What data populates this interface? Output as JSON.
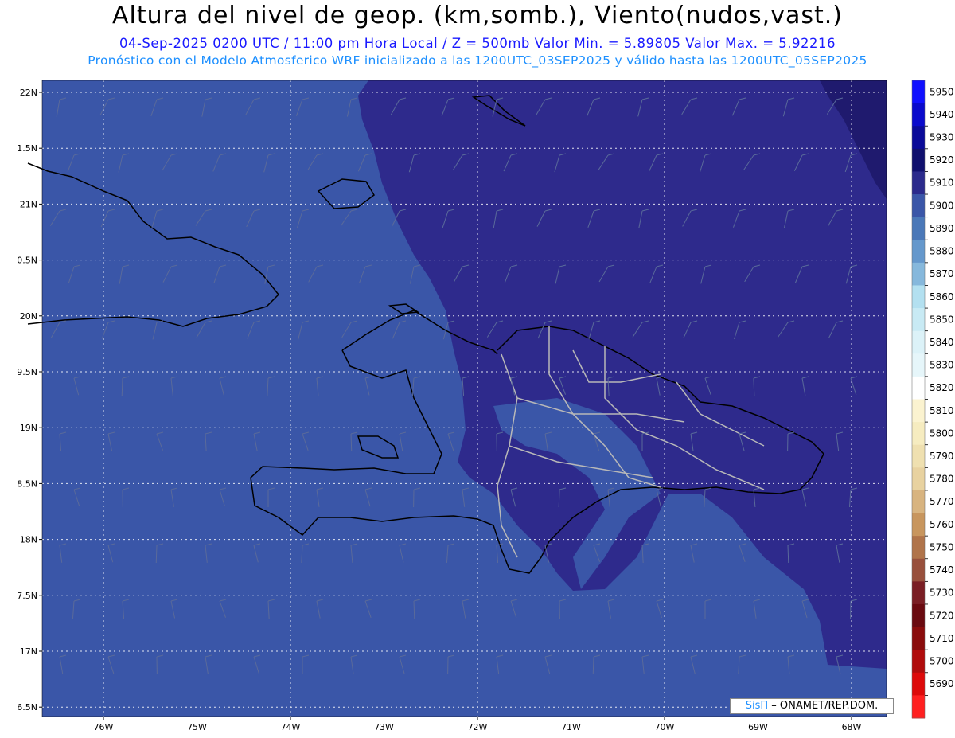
{
  "header": {
    "title": "Altura del nivel de geop. (km,somb.), Viento(nudos,vast.)",
    "subtitle": "04-Sep-2025  0200 UTC / 11:00 pm Hora Local / Z = 500mb    Valor Min. = 5.89805   Valor Max. = 5.92216",
    "subtitle2": "Pronóstico con el Modelo Atmosferico WRF inicializado a las 1200UTC_03SEP2025 y válido hasta las  1200UTC_05SEP2025"
  },
  "map": {
    "lat_labels": [
      "22N",
      "1.5N",
      "21N",
      "0.5N",
      "20N",
      "9.5N",
      "19N",
      "8.5N",
      "18N",
      "7.5N",
      "17N",
      "6.5N"
    ],
    "lon_labels": [
      "76W",
      "75W",
      "74W",
      "73W",
      "72W",
      "71W",
      "70W",
      "69W",
      "68W"
    ],
    "colors": {
      "ocean_fill": "#3a56a8",
      "high_fill": "#2e2a8c",
      "top_fill": "#1f1a6e",
      "coast": "#000000",
      "provinces": "#b0b0b0"
    }
  },
  "colorbar": {
    "labels": [
      "5950",
      "5940",
      "5930",
      "5920",
      "5910",
      "5900",
      "5890",
      "5880",
      "5870",
      "5860",
      "5850",
      "5840",
      "5830",
      "5820",
      "5810",
      "5800",
      "5790",
      "5780",
      "5770",
      "5760",
      "5750",
      "5740",
      "5730",
      "5720",
      "5710",
      "5700",
      "5690"
    ],
    "colors": [
      "#1010ff",
      "#0a0acc",
      "#0a0a99",
      "#10106e",
      "#2b2a8c",
      "#3a56a8",
      "#4a78b8",
      "#6598cc",
      "#86b8dc",
      "#b3e0f0",
      "#c8eaf4",
      "#dcf2f8",
      "#e6f6fa",
      "#ffffff",
      "#fbf3d0",
      "#f6ecc0",
      "#efe0b0",
      "#e8d2a0",
      "#d8b480",
      "#c8965e",
      "#b0744a",
      "#98503c",
      "#7a1e24",
      "#6a0a10",
      "#8a0c0c",
      "#b00c0c",
      "#dd0a0a",
      "#ff2020"
    ]
  },
  "credit": {
    "brand": "SisΠ",
    "text": "– ONAMET/REP.DOM."
  }
}
